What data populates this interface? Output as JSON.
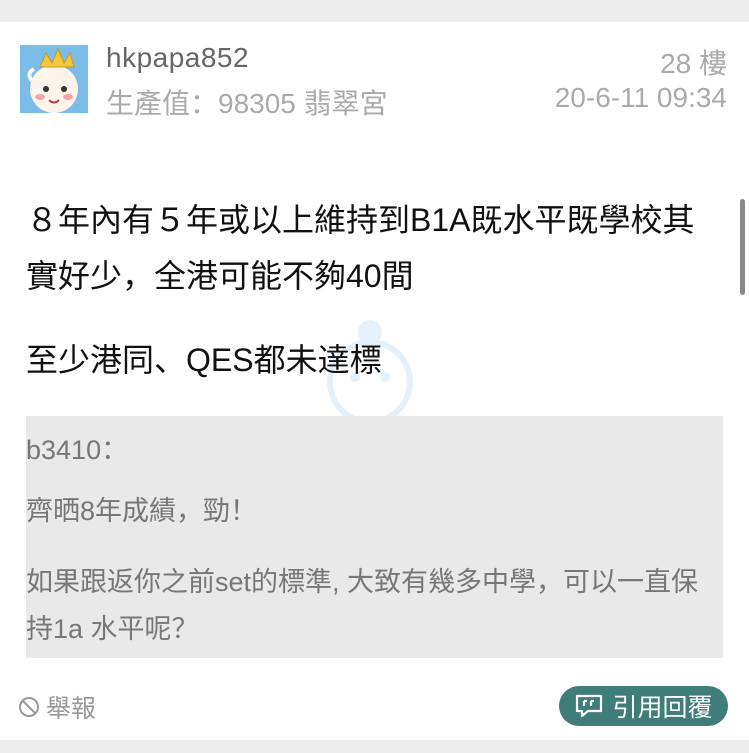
{
  "post": {
    "username": "hkpapa852",
    "meta": "生產值：98305 翡翠宮",
    "floor": "28 樓",
    "time": "20-6-11 09:34",
    "paragraphs": [
      "８年內有５年或以上維持到B1A既水平既學校其實好少，全港可能不夠40間",
      "至少港同、QES都未達標"
    ],
    "quote": {
      "author": "b3410：",
      "paragraphs": [
        "齊晒8年成績，勁！",
        "如果跟返你之前set的標準, 大致有幾多中學，可以一直保持1a 水平呢？"
      ]
    }
  },
  "actions": {
    "report_label": "舉報",
    "reply_label": "引用回覆"
  },
  "icons": {
    "avatar": "baby-king-avatar",
    "report": "ban-icon",
    "reply": "quote-reply-icon"
  },
  "colors": {
    "reply_button": "#3e7d78",
    "quote_bg": "#e9e9e9",
    "meta_text": "#aaaaaa"
  }
}
